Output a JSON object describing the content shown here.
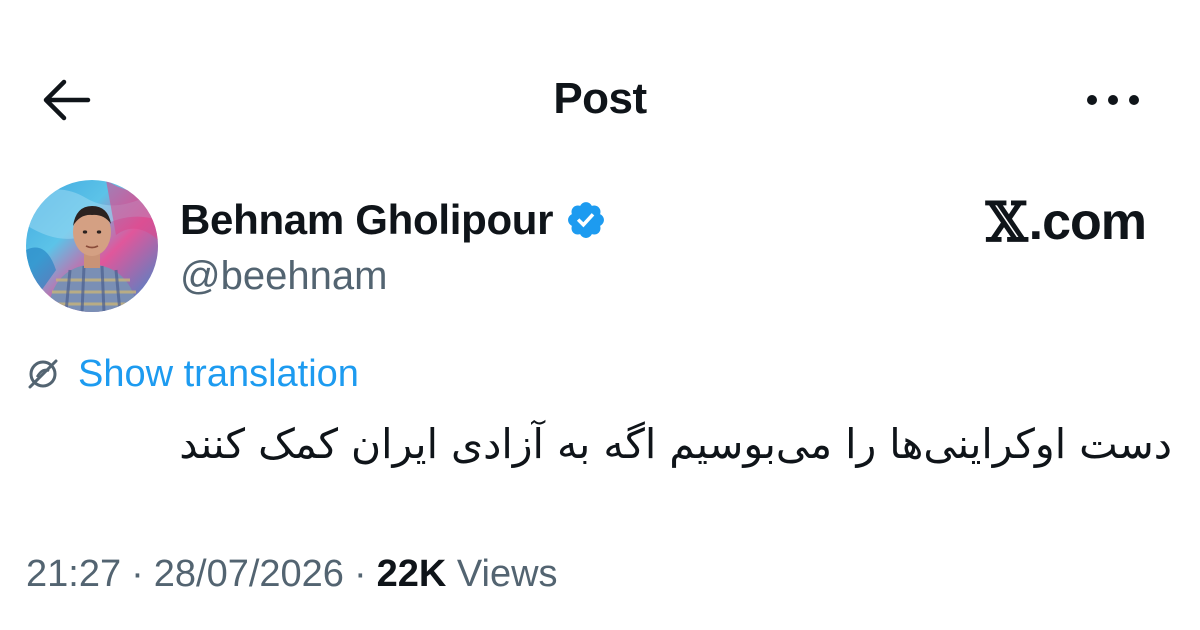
{
  "header": {
    "title": "Post",
    "back_icon": "arrow-left-icon",
    "more_icon": "more-horizontal-icon"
  },
  "author": {
    "name": "Behnam Gholipour",
    "handle": "@beehnam",
    "verified": true,
    "verified_color": "#1d9bf0"
  },
  "watermark": {
    "x_letter": "𝕏",
    "text": ".com"
  },
  "translation": {
    "label": "Show translation",
    "icon": "globe-translate-icon"
  },
  "tweet": {
    "text": "دست اوکراینی‌ها را می‌بوسیم اگه به آزادی ایران کمک کنند"
  },
  "meta": {
    "time": "21:27",
    "date": "28/07/2026",
    "views_count": "22K",
    "views_label": "Views",
    "separator": "·"
  },
  "colors": {
    "accent": "#1d9bf0",
    "text_primary": "#0f1419",
    "text_secondary": "#536471",
    "background": "#ffffff"
  }
}
